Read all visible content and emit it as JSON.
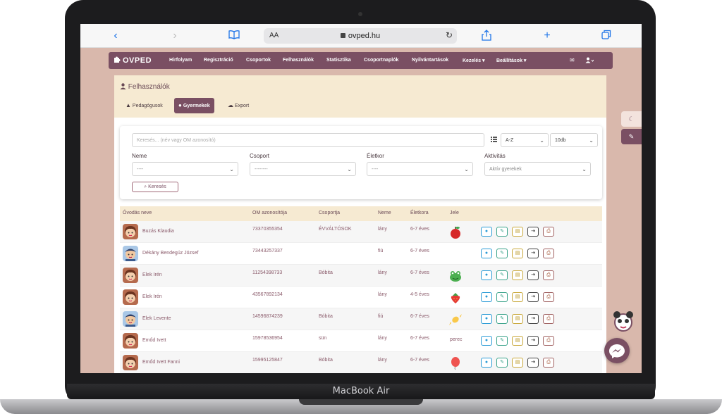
{
  "device": {
    "label": "MacBook Air"
  },
  "browser": {
    "url_aa": "AA",
    "url": "ovped.hu"
  },
  "navbar": {
    "brand": "OVPED",
    "items": [
      "Hírfolyam",
      "Regisztráció",
      "Csoportok",
      "Felhasználók",
      "Statisztika",
      "Csoportnaplók",
      "Nyilvántartások",
      "Kezelés ▾",
      "Beállítások ▾"
    ]
  },
  "panel": {
    "title": "Felhasználók",
    "tabs": [
      {
        "label": "Pedagógusok",
        "icon": "graduation-cap-icon"
      },
      {
        "label": "Gyermekek",
        "icon": "user-icon"
      },
      {
        "label": "Export",
        "icon": "cloud-download-icon"
      }
    ]
  },
  "filters": {
    "search_placeholder": "Keresés... (név vagy OM azonosító)",
    "sort_value": "A-Z",
    "page_size_value": "10db",
    "labels": {
      "gender": "Neme",
      "group": "Csoport",
      "age": "Életkor",
      "activity": "Aktivitás"
    },
    "values": {
      "gender": "----",
      "group": "--------",
      "age": "----",
      "activity": "Aktív gyerekek"
    },
    "search_button": "Keresés"
  },
  "table": {
    "headers": [
      "Óvodás neve",
      "OM azonosítója",
      "Csoportja",
      "Neme",
      "Életkora",
      "Jele"
    ],
    "rows": [
      {
        "name": "Buzás Klaudia",
        "om": "73370355354",
        "group": "ÉVVÁLTÓSOK",
        "gender": "lány",
        "age": "6-7 éves",
        "jele": "apple",
        "avatar": "girl"
      },
      {
        "name": "Dékány Bendegúz József",
        "om": "73443257337",
        "group": "",
        "gender": "fiú",
        "age": "6-7 éves",
        "jele": "",
        "avatar": "boy"
      },
      {
        "name": "Elek Irén",
        "om": "11254398733",
        "group": "Bóbita",
        "gender": "lány",
        "age": "6-7 éves",
        "jele": "frog",
        "avatar": "girl"
      },
      {
        "name": "Elek Irén",
        "om": "43567892134",
        "group": "",
        "gender": "lány",
        "age": "4-5 éves",
        "jele": "strawberry",
        "avatar": "girl"
      },
      {
        "name": "Elek Levente",
        "om": "14596874239",
        "group": "Bóbita",
        "gender": "fiú",
        "age": "6-7 éves",
        "jele": "candy",
        "avatar": "boy"
      },
      {
        "name": "Emőd Ivett",
        "om": "15978536954",
        "group": "sün",
        "gender": "lány",
        "age": "6-7 éves",
        "jele_text": "perec",
        "avatar": "girl"
      },
      {
        "name": "Emőd Ivett Fanni",
        "om": "15995125847",
        "group": "Bóbita",
        "gender": "lány",
        "age": "6-7 éves",
        "jele": "balloon",
        "avatar": "girl"
      }
    ]
  },
  "colors": {
    "brand": "#7a4f63",
    "header_bg": "#f6ead2",
    "page_bg": "#d9b8ac"
  }
}
